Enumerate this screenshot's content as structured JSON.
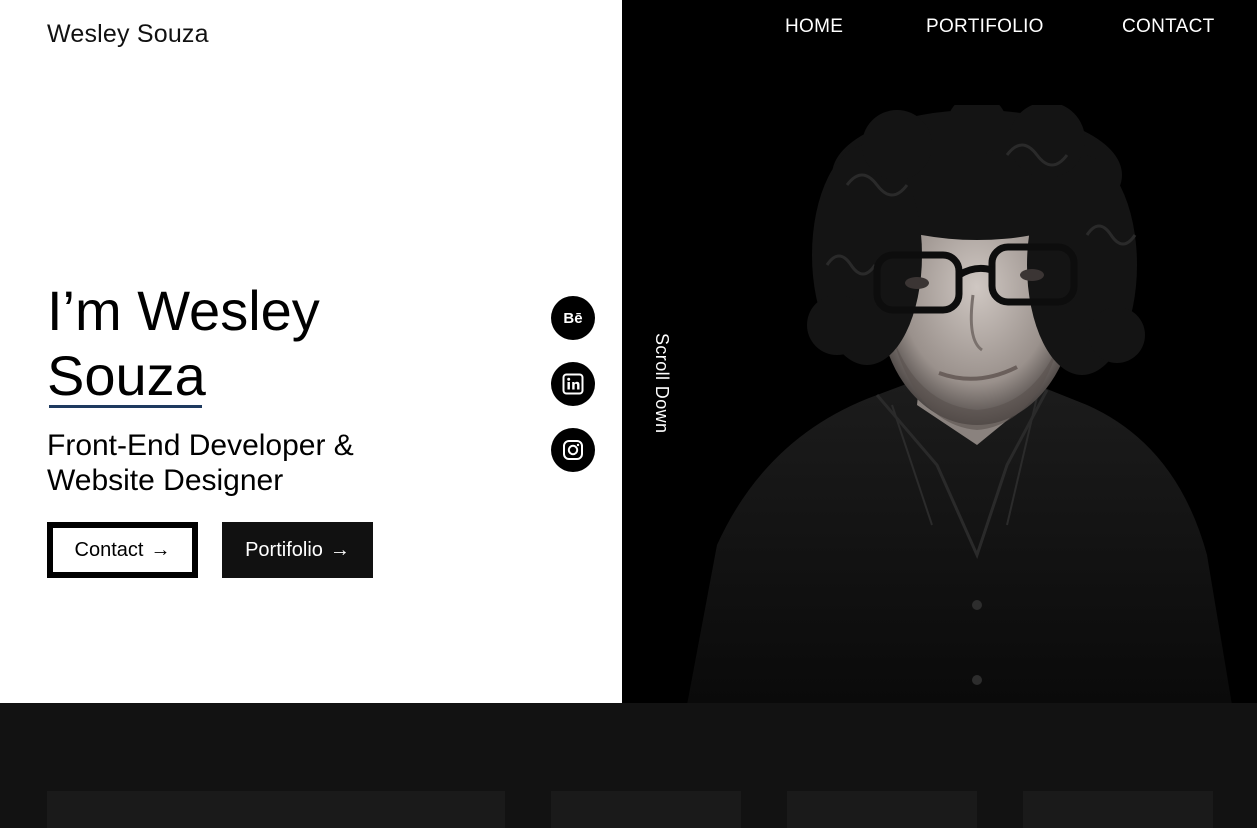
{
  "header": {
    "logo": "Wesley Souza",
    "nav": [
      "HOME",
      "PORTIFOLIO",
      "CONTACT"
    ]
  },
  "hero": {
    "title_line1": "I’m Wesley",
    "title_line2": "Souza",
    "subtitle_line1": "Front-End Developer &",
    "subtitle_line2": "Website Designer",
    "contact_button": "Contact",
    "portfolio_button": "Portifolio",
    "arrow": "→"
  },
  "social": {
    "behance": "Bē",
    "icons": [
      "behance-icon",
      "linkedin-icon",
      "instagram-icon"
    ]
  },
  "scroll_text": "Scroll Down",
  "colors": {
    "dark_panel": "#000000",
    "footer_bg": "#121212",
    "underline": "#1e3a5f"
  }
}
